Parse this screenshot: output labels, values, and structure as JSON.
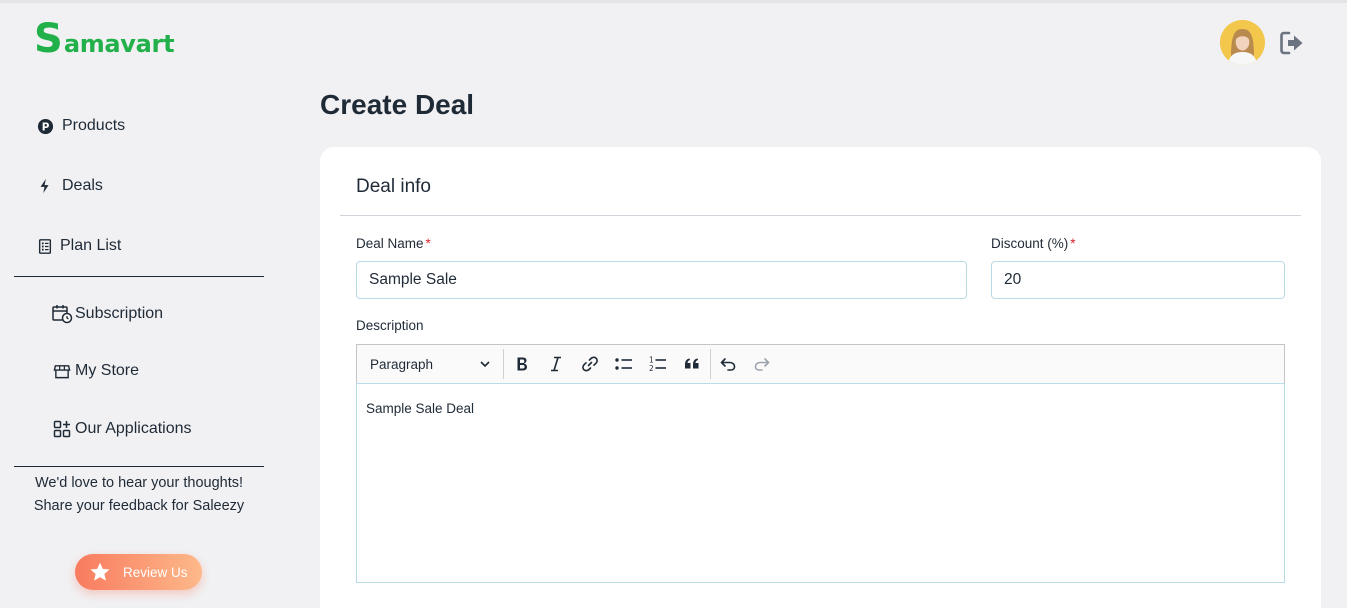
{
  "brand": {
    "logo_initial": "S",
    "logo_rest": "amavart",
    "color": "#22b04b"
  },
  "sidebar": {
    "items": [
      {
        "label": "Products",
        "icon": "p-circle-icon"
      },
      {
        "label": "Deals",
        "icon": "lightning-icon"
      },
      {
        "label": "Plan List",
        "icon": "list-icon"
      },
      {
        "label": "Subscription",
        "icon": "calendar-clock-icon"
      },
      {
        "label": "My Store",
        "icon": "store-icon"
      },
      {
        "label": "Our Applications",
        "icon": "apps-icon"
      }
    ],
    "feedback_text": "We'd love to hear your thoughts! Share your feedback for Saleezy",
    "review_button": "Review Us"
  },
  "header": {
    "avatar_icon": "user-avatar",
    "logout_icon": "logout-icon"
  },
  "page": {
    "title": "Create Deal"
  },
  "card": {
    "title": "Deal info",
    "deal_name": {
      "label": "Deal Name",
      "required": "*",
      "value": "Sample Sale"
    },
    "discount": {
      "label": "Discount (%)",
      "required": "*",
      "value": "20"
    },
    "description": {
      "label": "Description",
      "block_format": "Paragraph",
      "content": "Sample Sale Deal"
    }
  },
  "colors": {
    "accent": "#22b04b",
    "text": "#1f2a37",
    "required": "#d9262e",
    "review_from": "#f97b5f",
    "review_to": "#fdb98a"
  }
}
